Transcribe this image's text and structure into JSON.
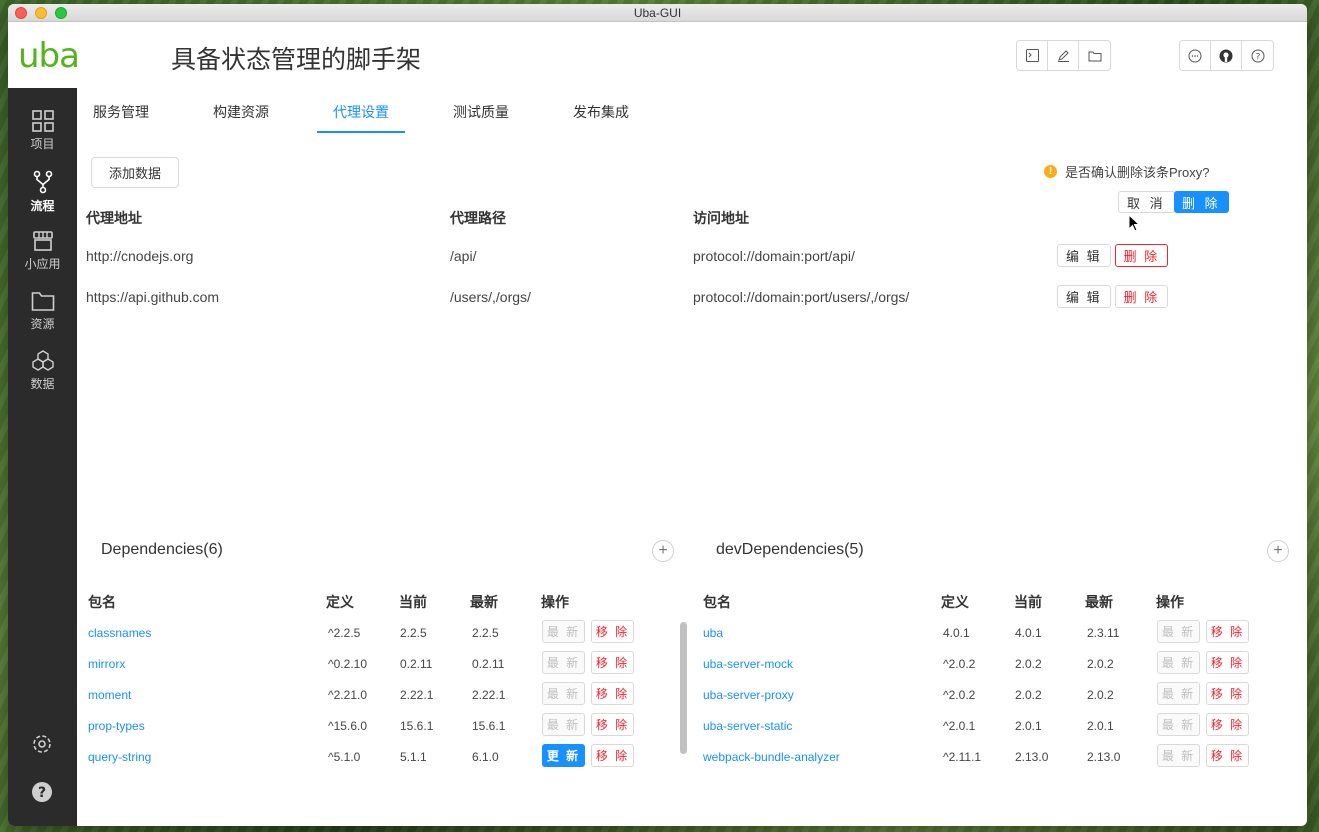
{
  "window": {
    "title": "Uba-GUI"
  },
  "header": {
    "logo_text": "uba",
    "project_title": "具备状态管理的脚手架",
    "left_actions": [
      "terminal-icon",
      "edit-icon",
      "folder-icon"
    ],
    "right_actions": [
      "chat-icon",
      "github-icon",
      "help-icon"
    ]
  },
  "sidebar": {
    "items": [
      {
        "label": "项目",
        "icon": "grid-icon"
      },
      {
        "label": "流程",
        "icon": "branch-icon",
        "active": true
      },
      {
        "label": "小应用",
        "icon": "store-icon"
      },
      {
        "label": "资源",
        "icon": "folder-icon"
      },
      {
        "label": "数据",
        "icon": "hexagons-icon"
      }
    ],
    "bottom": [
      "settings-icon",
      "help-icon"
    ]
  },
  "tabs": [
    {
      "label": "服务管理"
    },
    {
      "label": "构建资源"
    },
    {
      "label": "代理设置",
      "active": true
    },
    {
      "label": "测试质量"
    },
    {
      "label": "发布集成"
    }
  ],
  "proxy": {
    "add_label": "添加数据",
    "headers": [
      "代理地址",
      "代理路径",
      "访问地址"
    ],
    "rows": [
      {
        "address": "http://cnodejs.org",
        "path": "/api/",
        "access": "protocol://domain:port/api/"
      },
      {
        "address": "https://api.github.com",
        "path": "/users/,/orgs/",
        "access": "protocol://domain:port/users/,/orgs/"
      }
    ],
    "edit_label": "编 辑",
    "delete_label": "删 除"
  },
  "popconfirm": {
    "message": "是否确认删除该条Proxy?",
    "cancel": "取 消",
    "ok": "删 除"
  },
  "dependencies": {
    "title": "Dependencies(6)",
    "headers": [
      "包名",
      "定义",
      "当前",
      "最新",
      "操作"
    ],
    "rows": [
      {
        "name": "classnames",
        "wanted": "^2.2.5",
        "current": "2.2.5",
        "latest": "2.2.5",
        "action": "最 新",
        "updatable": false
      },
      {
        "name": "mirrorx",
        "wanted": "^0.2.10",
        "current": "0.2.11",
        "latest": "0.2.11",
        "action": "最 新",
        "updatable": false
      },
      {
        "name": "moment",
        "wanted": "^2.21.0",
        "current": "2.22.1",
        "latest": "2.22.1",
        "action": "最 新",
        "updatable": false
      },
      {
        "name": "prop-types",
        "wanted": "^15.6.0",
        "current": "15.6.1",
        "latest": "15.6.1",
        "action": "最 新",
        "updatable": false
      },
      {
        "name": "query-string",
        "wanted": "^5.1.0",
        "current": "5.1.1",
        "latest": "6.1.0",
        "action": "更 新",
        "updatable": true
      }
    ],
    "remove_label": "移 除"
  },
  "devDependencies": {
    "title": "devDependencies(5)",
    "headers": [
      "包名",
      "定义",
      "当前",
      "最新",
      "操作"
    ],
    "rows": [
      {
        "name": "uba",
        "wanted": "4.0.1",
        "current": "4.0.1",
        "latest": "2.3.11",
        "action": "最 新",
        "updatable": false
      },
      {
        "name": "uba-server-mock",
        "wanted": "^2.0.2",
        "current": "2.0.2",
        "latest": "2.0.2",
        "action": "最 新",
        "updatable": false
      },
      {
        "name": "uba-server-proxy",
        "wanted": "^2.0.2",
        "current": "2.0.2",
        "latest": "2.0.2",
        "action": "最 新",
        "updatable": false
      },
      {
        "name": "uba-server-static",
        "wanted": "^2.0.1",
        "current": "2.0.1",
        "latest": "2.0.1",
        "action": "最 新",
        "updatable": false
      },
      {
        "name": "webpack-bundle-analyzer",
        "wanted": "^2.11.1",
        "current": "2.13.0",
        "latest": "2.13.0",
        "action": "最 新",
        "updatable": false
      }
    ],
    "remove_label": "移 除"
  },
  "colors": {
    "accent": "#1890ff",
    "danger": "#f5222d",
    "brand": "#52b51c",
    "sidebar": "#2b2b2b",
    "warning": "#faad14"
  }
}
